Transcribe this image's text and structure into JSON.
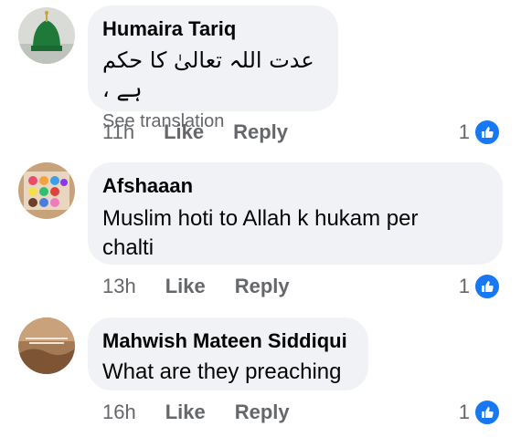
{
  "comments": [
    {
      "author": "Humaira Tariq",
      "text": "عدت اللہ تعالیٰ کا حکم ہے ،",
      "see_translation": "See translation",
      "time": "11h",
      "like_label": "Like",
      "reply_label": "Reply",
      "reaction_count": "1",
      "avatar_icon": "green-dome-icon"
    },
    {
      "author": "Afshaaan",
      "text_line1": "Muslim hoti to Allah k hukam per",
      "text_line2": "chalti",
      "time": "13h",
      "like_label": "Like",
      "reply_label": "Reply",
      "reaction_count": "1",
      "avatar_icon": "eyeshadow-palette-icon"
    },
    {
      "author": "Mahwish Mateen Siddiqui",
      "text": "What are they preaching",
      "time": "16h",
      "like_label": "Like",
      "reply_label": "Reply",
      "reaction_count": "1",
      "avatar_icon": "brown-photo-icon"
    }
  ],
  "colors": {
    "bubble": "#f0f2f5",
    "meta_text": "#65676b",
    "like_blue": "#1877f2"
  }
}
